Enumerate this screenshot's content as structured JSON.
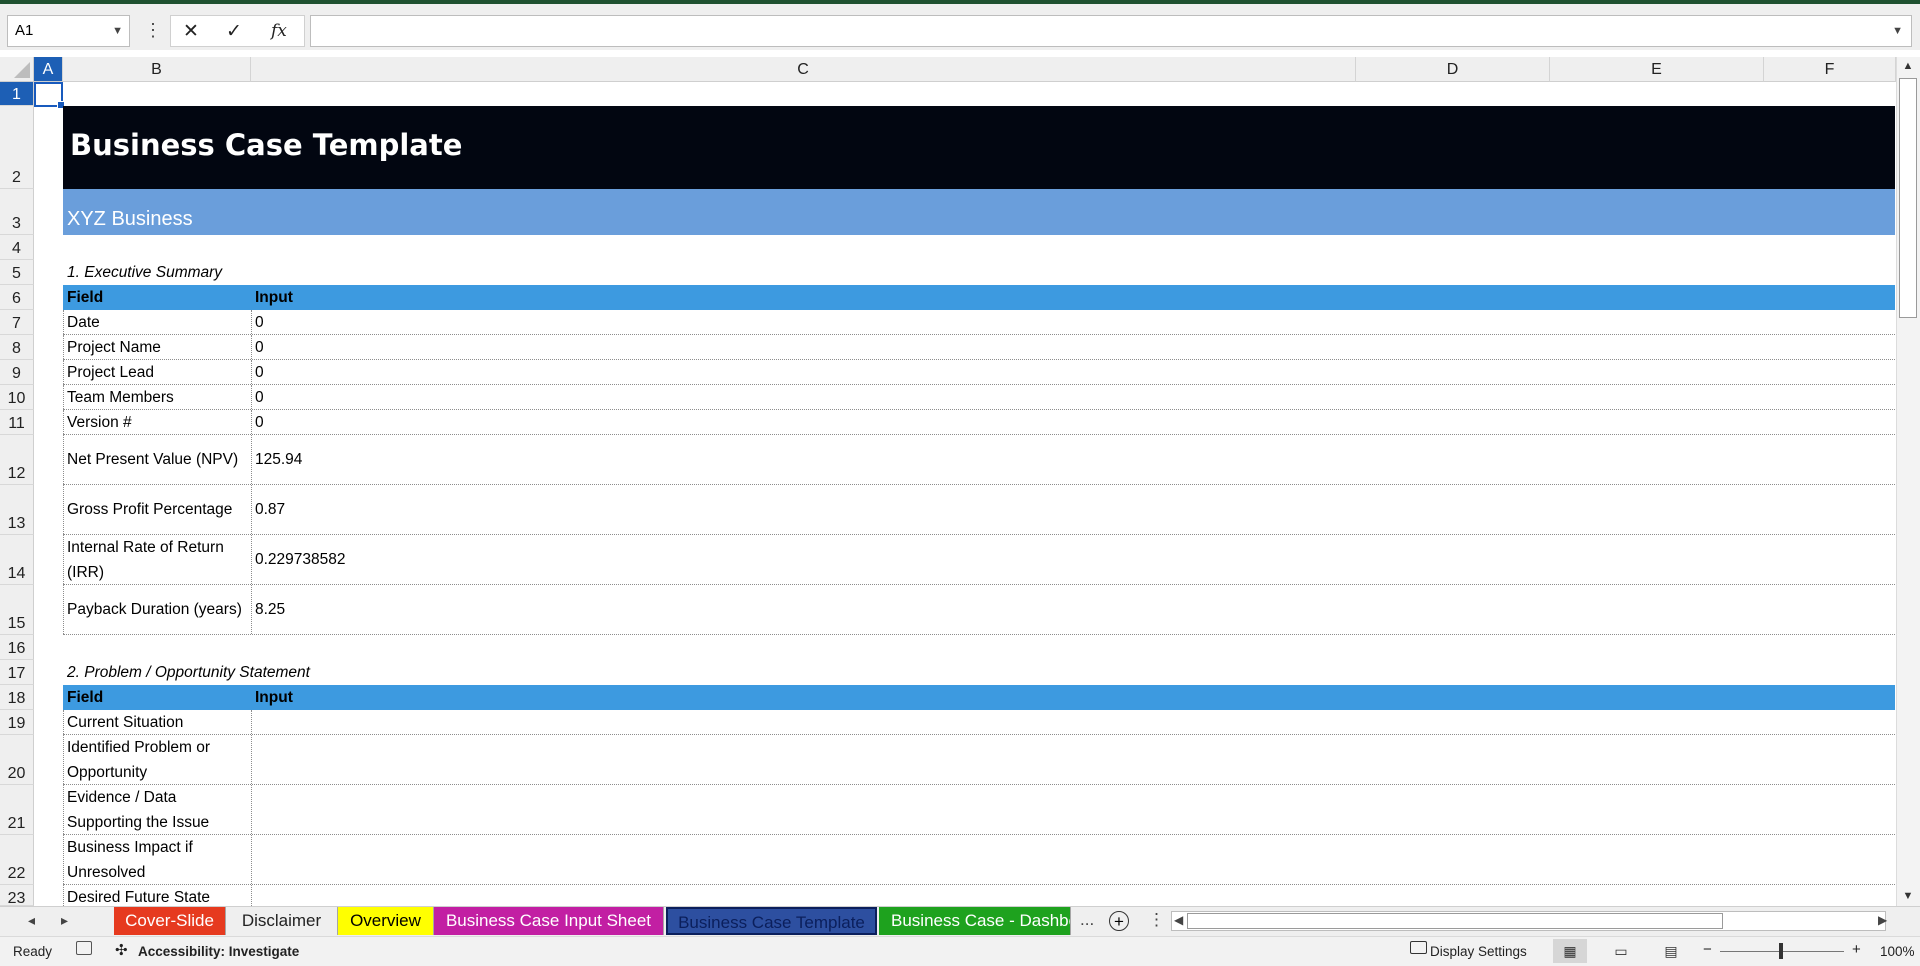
{
  "formula_bar": {
    "name_box": "A1",
    "cancel_icon": "✕",
    "enter_icon": "✓",
    "fx_label": "fx",
    "formula": ""
  },
  "column_headers": [
    "A",
    "B",
    "C",
    "D",
    "E",
    "F"
  ],
  "row_headers": [
    "1",
    "2",
    "3",
    "4",
    "5",
    "6",
    "7",
    "8",
    "9",
    "10",
    "11",
    "12",
    "13",
    "14",
    "15",
    "16",
    "17",
    "18",
    "19",
    "20",
    "21",
    "22",
    "23"
  ],
  "sheet": {
    "title": "Business Case Template",
    "subtitle": "XYZ Business",
    "section1": {
      "heading": "1. Executive Summary",
      "col_field": "Field",
      "col_input": "Input",
      "rows": [
        {
          "field": "Date",
          "value": "0"
        },
        {
          "field": "Project Name",
          "value": "0"
        },
        {
          "field": "Project Lead",
          "value": "0"
        },
        {
          "field": "Team Members",
          "value": "0"
        },
        {
          "field": "Version #",
          "value": "0"
        },
        {
          "field": "Net Present Value (NPV)",
          "value": "125.94"
        },
        {
          "field": "Gross Profit Percentage",
          "value": "0.87"
        },
        {
          "field_line1": "Internal Rate of Return",
          "field_line2": "(IRR)",
          "value": "0.229738582"
        },
        {
          "field": "Payback Duration (years)",
          "value": "8.25"
        }
      ]
    },
    "section2": {
      "heading": "2. Problem / Opportunity Statement",
      "col_field": "Field",
      "col_input": "Input",
      "rows": [
        {
          "field": "Current Situation"
        },
        {
          "field_line1": "Identified Problem or",
          "field_line2": "Opportunity"
        },
        {
          "field_line1": "Evidence / Data",
          "field_line2": "Supporting the Issue"
        },
        {
          "field_line1": "Business Impact if",
          "field_line2": "Unresolved"
        },
        {
          "field": "Desired Future State"
        }
      ]
    }
  },
  "tabs": {
    "items": [
      {
        "label": "Cover-Slide",
        "bg": "#e63a1f",
        "color": "#ffffff"
      },
      {
        "label": "Disclaimer",
        "bg": "#efefef",
        "color": "#222222"
      },
      {
        "label": "Overview",
        "bg": "#ffff00",
        "color": "#000000"
      },
      {
        "label": "Business Case Input Sheet",
        "bg": "#c21fa3",
        "color": "#ffffff"
      },
      {
        "label": "Business Case Template",
        "bg": "#0b1f5c",
        "color": "#0b1f5c"
      },
      {
        "label": "Business Case - Dashbo",
        "bg": "#1ea21e",
        "color": "#ffffff"
      }
    ],
    "more": "...",
    "add_icon": "+"
  },
  "status_bar": {
    "ready": "Ready",
    "accessibility": "Accessibility: Investigate",
    "display_settings": "Display Settings",
    "zoom": "100%",
    "zoom_minus": "−",
    "zoom_plus": "+"
  }
}
